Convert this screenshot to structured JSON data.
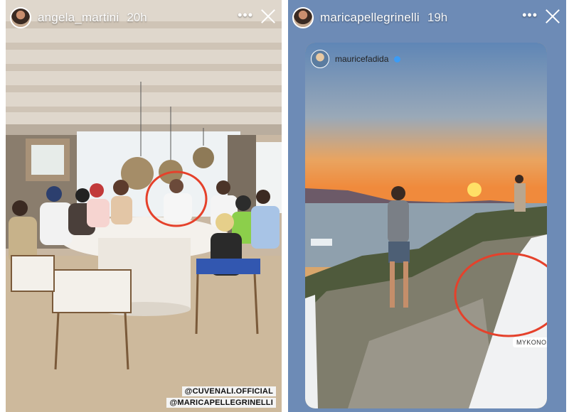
{
  "left_story": {
    "username": "angela_martini",
    "time": "20h",
    "more_icon": "more-horizontal-icon",
    "close_icon": "close-icon",
    "tags": [
      "@CUVENALI.OFFICIAL",
      "@MARICAPELLEGRINELLI"
    ]
  },
  "right_story": {
    "username": "maricapellegrinelli",
    "time": "19h",
    "more_icon": "more-horizontal-icon",
    "close_icon": "close-icon",
    "reshared_post": {
      "username": "mauricefadida",
      "verified": true,
      "location_sticker": "MYKONOS"
    }
  },
  "colors": {
    "right_panel_bg": "#6d8bb6",
    "circle_highlight": "#e5412b"
  }
}
